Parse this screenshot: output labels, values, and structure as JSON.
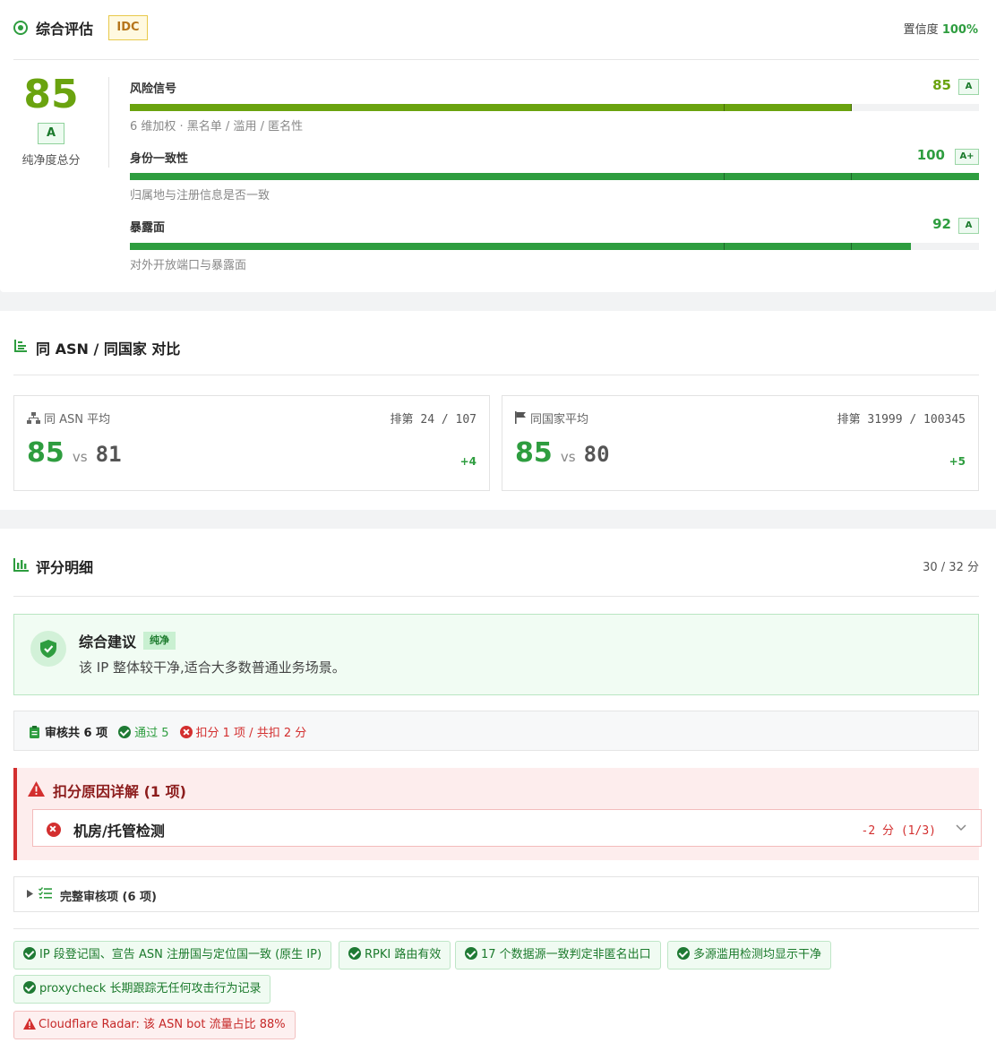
{
  "overview": {
    "title": "综合评估",
    "badge": "IDC",
    "confidence_label": "置信度",
    "confidence_value": "100%",
    "score": "85",
    "grade": "A",
    "score_label": "纯净度总分",
    "rows": [
      {
        "name": "风险信号",
        "value": "85",
        "grade": "A",
        "desc": "6 维加权 · 黑名单 / 滥用 / 匿名性",
        "fill": 0.85,
        "color": "#6aa30f",
        "value_color": "#6aa30f"
      },
      {
        "name": "身份一致性",
        "value": "100",
        "grade": "A+",
        "desc": "归属地与注册信息是否一致",
        "fill": 1.0,
        "color": "#2e9d3f",
        "value_color": "#2e9d3f"
      },
      {
        "name": "暴露面",
        "value": "92",
        "grade": "A",
        "desc": "对外开放端口与暴露面",
        "fill": 0.92,
        "color": "#2e9d3f",
        "value_color": "#2e9d3f"
      }
    ]
  },
  "compare": {
    "title": "同 ASN / 同国家 对比",
    "cards": [
      {
        "label": "同 ASN 平均",
        "rank_label": "排第",
        "rank": "24 / 107",
        "score": "85",
        "vs": "vs",
        "avg": "81",
        "delta": "+4",
        "icon": "network-icon"
      },
      {
        "label": "同国家平均",
        "rank_label": "排第",
        "rank": "31999 / 100345",
        "score": "85",
        "vs": "vs",
        "avg": "80",
        "delta": "+5",
        "icon": "flag-icon"
      }
    ]
  },
  "detail": {
    "title": "评分明细",
    "total": "30 / 32 分",
    "advice_title": "综合建议",
    "advice_tag": "纯净",
    "advice_text": "该 IP 整体较干净,适合大多数普通业务场景。",
    "audit_total": "审核共 6 项",
    "audit_pass": "通过 5",
    "audit_deduct": "扣分 1 项 / 共扣 2 分",
    "deduct_title": "扣分原因详解 (1 项)",
    "deduct_item": "机房/托管检测",
    "deduct_score": "-2 分 (1/3)",
    "full_audit": "完整审核项 (6 项)",
    "chips": [
      "IP 段登记国、宣告 ASN 注册国与定位国一致 (原生 IP)",
      "RPKI 路由有效",
      "17 个数据源一致判定非匿名出口",
      "多源滥用检测均显示干净",
      "proxycheck 长期跟踪无任何攻击行为记录"
    ],
    "warn_chip": "Cloudflare Radar: 该 ASN bot 流量占比 88%"
  }
}
